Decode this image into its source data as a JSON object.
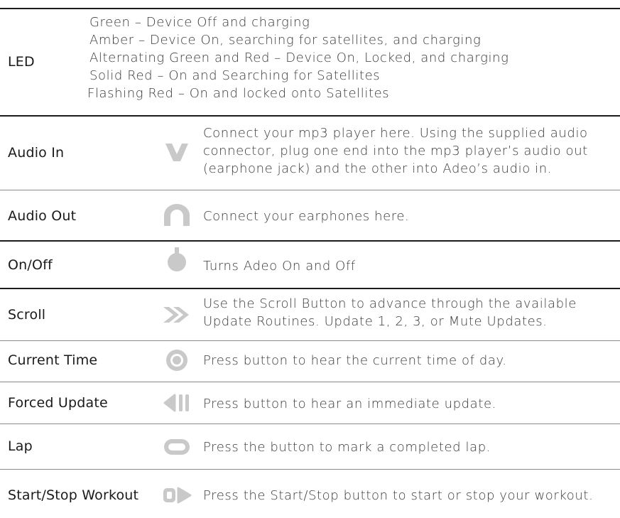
{
  "rows": [
    {
      "label": "LED",
      "lines": [
        "Green – Device Off and charging",
        "Amber – Device On, searching for satellites, and charging",
        "Alternating Green and Red – Device On, Locked, and charging",
        "Solid Red – On and Searching for Satellites",
        "Flashing Red – On and locked onto Satellites"
      ]
    },
    {
      "label": "Audio In",
      "icon": "v-shape-icon",
      "lines": [
        "Connect your mp3 player here. Using the supplied audio",
        "connector, plug one end into the mp3 player’s audio out",
        "(earphone jack) and the other into Adeo’s audio in."
      ]
    },
    {
      "label": "Audio Out",
      "icon": "arch-icon",
      "lines": [
        "Connect your earphones here."
      ]
    },
    {
      "label": "On/Off",
      "icon": "power-icon",
      "lines": [
        "Turns Adeo On and Off"
      ]
    },
    {
      "label": "Scroll",
      "icon": "double-chevron-right-icon",
      "lines": [
        "Use the Scroll Button to advance through the available",
        "Update Routines. Update 1, 2, 3, or Mute Updates."
      ]
    },
    {
      "label": "Current Time",
      "icon": "target-circle-icon",
      "lines": [
        "Press button to hear the current time of day."
      ]
    },
    {
      "label": "Forced Update",
      "icon": "back-pause-icon",
      "lines": [
        "Press button to hear an immediate update."
      ]
    },
    {
      "label": "Lap",
      "icon": "rounded-rectangle-icon",
      "lines": [
        "Press the button to mark a completed lap."
      ]
    },
    {
      "label": "Start/Stop Workout",
      "icon": "stop-play-icon",
      "lines": [
        "Press the Start/Stop button to start or stop your workout."
      ]
    }
  ],
  "colors": {
    "rule": "#1c1c1c",
    "icon": "#c9c9c9",
    "text": "#3a3a3a"
  }
}
